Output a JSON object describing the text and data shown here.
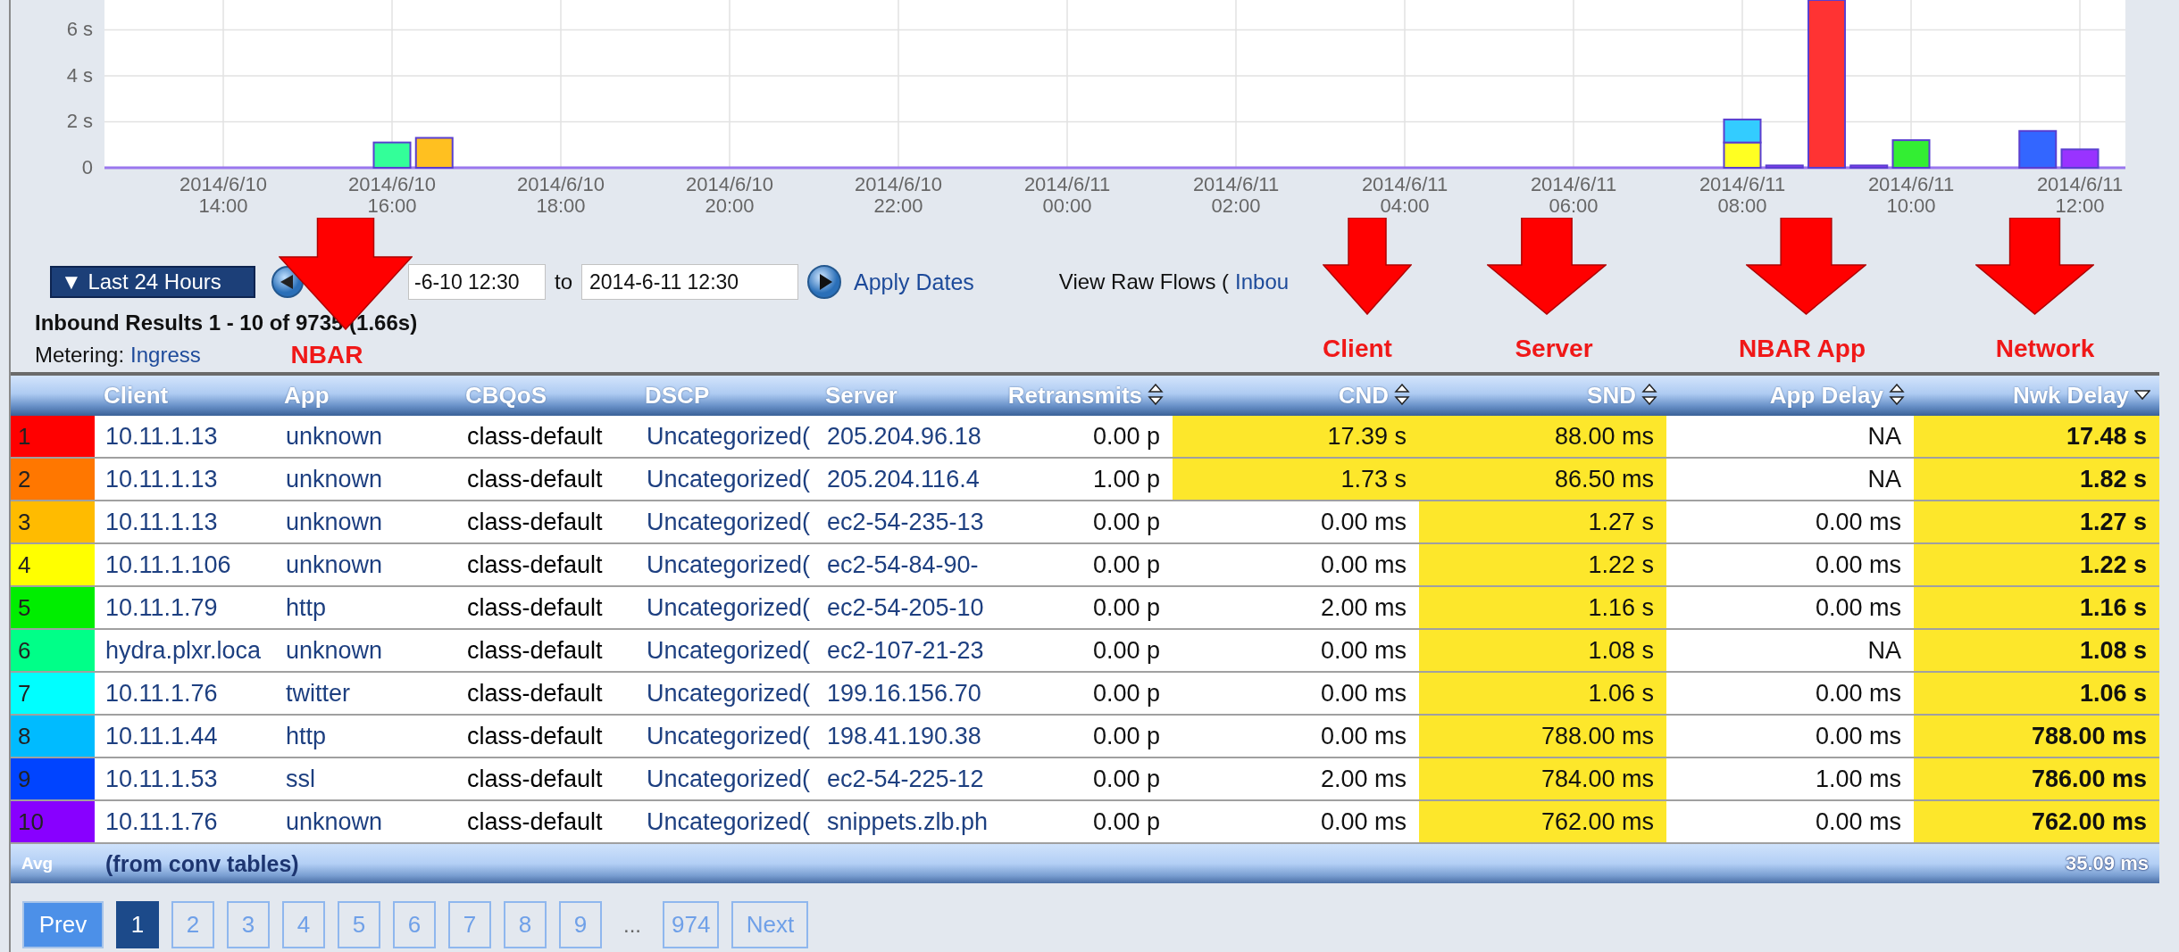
{
  "chart": {
    "chart_data": {
      "type": "bar",
      "stacked": true,
      "grid": true,
      "categories": [
        "2014/6/10 14:00",
        null,
        null,
        null,
        "2014/6/10 16:00",
        null,
        null,
        null,
        "2014/6/10 18:00",
        null,
        null,
        null,
        "2014/6/10 20:00",
        null,
        null,
        null,
        "2014/6/10 22:00",
        null,
        null,
        null,
        "2014/6/11 00:00",
        null,
        null,
        null,
        "2014/6/11 02:00",
        null,
        null,
        null,
        "2014/6/11 04:00",
        null,
        null,
        null,
        "2014/6/11 06:00",
        null,
        null,
        null,
        "2014/6/11 08:00",
        null,
        null,
        null,
        "2014/6/11 10:00",
        null,
        null,
        null,
        "2014/6/11 12:00",
        null
      ],
      "ylim": [
        0,
        7.3
      ],
      "yticks": [
        {
          "value": 0,
          "label": "0"
        },
        {
          "value": 2,
          "label": "2 s"
        },
        {
          "value": 4,
          "label": "4 s"
        },
        {
          "value": 6,
          "label": "6 s"
        }
      ],
      "series": [
        {
          "color": "#33ff99",
          "values": [
            null,
            null,
            null,
            null,
            1.1,
            null,
            null,
            null,
            null,
            null,
            null,
            null,
            null,
            null,
            null,
            null,
            null,
            null,
            null,
            null,
            null,
            null,
            null,
            null,
            null,
            null,
            null,
            null,
            null,
            null,
            null,
            null,
            null,
            null,
            null,
            null,
            null,
            null,
            null,
            null,
            null,
            null,
            null,
            null,
            null,
            null
          ]
        },
        {
          "color": "#ffc020",
          "values": [
            null,
            null,
            null,
            null,
            null,
            1.3,
            null,
            null,
            null,
            null,
            null,
            null,
            null,
            null,
            null,
            null,
            null,
            null,
            null,
            null,
            null,
            null,
            null,
            null,
            null,
            null,
            null,
            null,
            null,
            null,
            null,
            null,
            null,
            null,
            null,
            null,
            null,
            null,
            null,
            null,
            null,
            null,
            null,
            null,
            null,
            null
          ]
        },
        {
          "color": "#ffff22",
          "values": [
            null,
            null,
            null,
            null,
            null,
            null,
            null,
            null,
            null,
            null,
            null,
            null,
            null,
            null,
            null,
            null,
            null,
            null,
            null,
            null,
            null,
            null,
            null,
            null,
            null,
            null,
            null,
            null,
            null,
            null,
            null,
            null,
            null,
            null,
            null,
            null,
            1.1,
            null,
            null,
            null,
            null,
            null,
            null,
            null,
            null,
            null
          ]
        },
        {
          "color": "#33ccff",
          "values": [
            null,
            null,
            null,
            null,
            null,
            null,
            null,
            null,
            null,
            null,
            null,
            null,
            null,
            null,
            null,
            null,
            null,
            null,
            null,
            null,
            null,
            null,
            null,
            null,
            null,
            null,
            null,
            null,
            null,
            null,
            null,
            null,
            null,
            null,
            null,
            null,
            1.0,
            null,
            null,
            null,
            null,
            null,
            null,
            null,
            null,
            null
          ]
        },
        {
          "color": "#9933ff",
          "values": [
            null,
            null,
            null,
            null,
            null,
            null,
            null,
            null,
            null,
            null,
            null,
            null,
            null,
            null,
            null,
            null,
            null,
            null,
            null,
            null,
            null,
            null,
            null,
            null,
            null,
            null,
            null,
            null,
            null,
            null,
            null,
            null,
            null,
            null,
            null,
            null,
            null,
            0.1,
            null,
            0.1,
            null,
            null,
            null,
            null,
            0.8,
            null
          ]
        },
        {
          "color": "#ff3333",
          "values": [
            null,
            null,
            null,
            null,
            null,
            null,
            null,
            null,
            null,
            null,
            null,
            null,
            null,
            null,
            null,
            null,
            null,
            null,
            null,
            null,
            null,
            null,
            null,
            null,
            null,
            null,
            null,
            null,
            null,
            null,
            null,
            null,
            null,
            null,
            null,
            null,
            null,
            null,
            7.3,
            null,
            null,
            null,
            null,
            null,
            null,
            null
          ]
        },
        {
          "color": "#33ee33",
          "values": [
            null,
            null,
            null,
            null,
            null,
            null,
            null,
            null,
            null,
            null,
            null,
            null,
            null,
            null,
            null,
            null,
            null,
            null,
            null,
            null,
            null,
            null,
            null,
            null,
            null,
            null,
            null,
            null,
            null,
            null,
            null,
            null,
            null,
            null,
            null,
            null,
            null,
            null,
            null,
            null,
            1.2,
            null,
            null,
            null,
            null,
            null
          ]
        },
        {
          "color": "#3366ff",
          "values": [
            null,
            null,
            null,
            null,
            null,
            null,
            null,
            null,
            null,
            null,
            null,
            null,
            null,
            null,
            null,
            null,
            null,
            null,
            null,
            null,
            null,
            null,
            null,
            null,
            null,
            null,
            null,
            null,
            null,
            null,
            null,
            null,
            null,
            null,
            null,
            null,
            null,
            null,
            null,
            null,
            null,
            null,
            null,
            1.6,
            null,
            null
          ]
        }
      ]
    }
  },
  "date_range": {
    "preset": "▼ Last 24 Hours",
    "from": "-6-10 12:30",
    "to_label": "to",
    "to": "2014-6-11 12:30",
    "apply": "Apply Dates"
  },
  "raw_flows": {
    "label": "View Raw Flows (",
    "link": "Inbou"
  },
  "results_title": "Inbound Results 1 - 10 of 9735 (1.66s)",
  "metering": {
    "label": "Metering:",
    "value": "Ingress"
  },
  "table": {
    "columns": [
      {
        "label": "Client",
        "sortable": false
      },
      {
        "label": "App",
        "sortable": false
      },
      {
        "label": "CBQoS",
        "sortable": false
      },
      {
        "label": "DSCP",
        "sortable": false
      },
      {
        "label": "Server",
        "sortable": false
      },
      {
        "label": "Retransmits",
        "sortable": true,
        "sorted": false
      },
      {
        "label": "CND",
        "sortable": true,
        "sorted": false
      },
      {
        "label": "SND",
        "sortable": true,
        "sorted": false
      },
      {
        "label": "App Delay",
        "sortable": true,
        "sorted": false
      },
      {
        "label": "Nwk Delay",
        "sortable": true,
        "sorted": true
      }
    ],
    "rows": [
      {
        "rank": "1",
        "color": "#ff0000",
        "client": "10.11.1.13",
        "app": "unknown",
        "cbqos": "class-default",
        "dscp": "Uncategorized(",
        "server": "205.204.96.18",
        "metrics": [
          {
            "value": "0.00 p",
            "highlighted": false
          },
          {
            "value": "17.39 s",
            "highlighted": true
          },
          {
            "value": "88.00 ms",
            "highlighted": true
          },
          {
            "value": "NA",
            "highlighted": false
          },
          {
            "value": "17.48 s",
            "highlighted": true
          }
        ]
      },
      {
        "rank": "2",
        "color": "#ff7700",
        "client": "10.11.1.13",
        "app": "unknown",
        "cbqos": "class-default",
        "dscp": "Uncategorized(",
        "server": "205.204.116.4",
        "metrics": [
          {
            "value": "1.00 p",
            "highlighted": false
          },
          {
            "value": "1.73 s",
            "highlighted": true
          },
          {
            "value": "86.50 ms",
            "highlighted": true
          },
          {
            "value": "NA",
            "highlighted": false
          },
          {
            "value": "1.82 s",
            "highlighted": true
          }
        ]
      },
      {
        "rank": "3",
        "color": "#ffbb00",
        "client": "10.11.1.13",
        "app": "unknown",
        "cbqos": "class-default",
        "dscp": "Uncategorized(",
        "server": "ec2-54-235-13",
        "metrics": [
          {
            "value": "0.00 p",
            "highlighted": false
          },
          {
            "value": "0.00 ms",
            "highlighted": false
          },
          {
            "value": "1.27 s",
            "highlighted": true
          },
          {
            "value": "0.00 ms",
            "highlighted": false
          },
          {
            "value": "1.27 s",
            "highlighted": true
          }
        ]
      },
      {
        "rank": "4",
        "color": "#ffff00",
        "client": "10.11.1.106",
        "app": "unknown",
        "cbqos": "class-default",
        "dscp": "Uncategorized(",
        "server": "ec2-54-84-90-",
        "metrics": [
          {
            "value": "0.00 p",
            "highlighted": false
          },
          {
            "value": "0.00 ms",
            "highlighted": false
          },
          {
            "value": "1.22 s",
            "highlighted": true
          },
          {
            "value": "0.00 ms",
            "highlighted": false
          },
          {
            "value": "1.22 s",
            "highlighted": true
          }
        ]
      },
      {
        "rank": "5",
        "color": "#00ee00",
        "client": "10.11.1.79",
        "app": "http",
        "cbqos": "class-default",
        "dscp": "Uncategorized(",
        "server": "ec2-54-205-10",
        "metrics": [
          {
            "value": "0.00 p",
            "highlighted": false
          },
          {
            "value": "2.00 ms",
            "highlighted": false
          },
          {
            "value": "1.16 s",
            "highlighted": true
          },
          {
            "value": "0.00 ms",
            "highlighted": false
          },
          {
            "value": "1.16 s",
            "highlighted": true
          }
        ]
      },
      {
        "rank": "6",
        "color": "#00ff88",
        "client": "hydra.plxr.loca",
        "app": "unknown",
        "cbqos": "class-default",
        "dscp": "Uncategorized(",
        "server": "ec2-107-21-23",
        "metrics": [
          {
            "value": "0.00 p",
            "highlighted": false
          },
          {
            "value": "0.00 ms",
            "highlighted": false
          },
          {
            "value": "1.08 s",
            "highlighted": true
          },
          {
            "value": "NA",
            "highlighted": false
          },
          {
            "value": "1.08 s",
            "highlighted": true
          }
        ]
      },
      {
        "rank": "7",
        "color": "#00ffff",
        "client": "10.11.1.76",
        "app": "twitter",
        "cbqos": "class-default",
        "dscp": "Uncategorized(",
        "server": "199.16.156.70",
        "metrics": [
          {
            "value": "0.00 p",
            "highlighted": false
          },
          {
            "value": "0.00 ms",
            "highlighted": false
          },
          {
            "value": "1.06 s",
            "highlighted": true
          },
          {
            "value": "0.00 ms",
            "highlighted": false
          },
          {
            "value": "1.06 s",
            "highlighted": true
          }
        ]
      },
      {
        "rank": "8",
        "color": "#00bbff",
        "client": "10.11.1.44",
        "app": "http",
        "cbqos": "class-default",
        "dscp": "Uncategorized(",
        "server": "198.41.190.38",
        "metrics": [
          {
            "value": "0.00 p",
            "highlighted": false
          },
          {
            "value": "0.00 ms",
            "highlighted": false
          },
          {
            "value": "788.00 ms",
            "highlighted": true
          },
          {
            "value": "0.00 ms",
            "highlighted": false
          },
          {
            "value": "788.00 ms",
            "highlighted": true
          }
        ]
      },
      {
        "rank": "9",
        "color": "#0044ff",
        "client": "10.11.1.53",
        "app": "ssl",
        "cbqos": "class-default",
        "dscp": "Uncategorized(",
        "server": "ec2-54-225-12",
        "metrics": [
          {
            "value": "0.00 p",
            "highlighted": false
          },
          {
            "value": "2.00 ms",
            "highlighted": false
          },
          {
            "value": "784.00 ms",
            "highlighted": true
          },
          {
            "value": "1.00 ms",
            "highlighted": false
          },
          {
            "value": "786.00 ms",
            "highlighted": true
          }
        ]
      },
      {
        "rank": "10",
        "color": "#8800ff",
        "client": "10.11.1.76",
        "app": "unknown",
        "cbqos": "class-default",
        "dscp": "Uncategorized(",
        "server": "snippets.zlb.ph",
        "metrics": [
          {
            "value": "0.00 p",
            "highlighted": false
          },
          {
            "value": "0.00 ms",
            "highlighted": false
          },
          {
            "value": "762.00 ms",
            "highlighted": true
          },
          {
            "value": "0.00 ms",
            "highlighted": false
          },
          {
            "value": "762.00 ms",
            "highlighted": true
          }
        ]
      }
    ],
    "avg": {
      "label": "Avg",
      "note": "(from conv tables)",
      "value": "35.09 ms"
    }
  },
  "pagination": [
    {
      "label": "Prev",
      "kind": "prev"
    },
    {
      "label": "1",
      "kind": "page",
      "selected": true
    },
    {
      "label": "2",
      "kind": "page",
      "selected": false
    },
    {
      "label": "3",
      "kind": "page",
      "selected": false
    },
    {
      "label": "4",
      "kind": "page",
      "selected": false
    },
    {
      "label": "5",
      "kind": "page",
      "selected": false
    },
    {
      "label": "6",
      "kind": "page",
      "selected": false
    },
    {
      "label": "7",
      "kind": "page",
      "selected": false
    },
    {
      "label": "8",
      "kind": "page",
      "selected": false
    },
    {
      "label": "9",
      "kind": "page",
      "selected": false
    },
    {
      "label": "...",
      "kind": "ellipsis"
    },
    {
      "label": "974",
      "kind": "page",
      "selected": false
    },
    {
      "label": "Next",
      "kind": "next"
    }
  ],
  "annotations": [
    {
      "text": "NBAR"
    },
    {
      "text": "Client"
    },
    {
      "text": "Server"
    },
    {
      "text": "NBAR App"
    },
    {
      "text": "Network"
    }
  ]
}
